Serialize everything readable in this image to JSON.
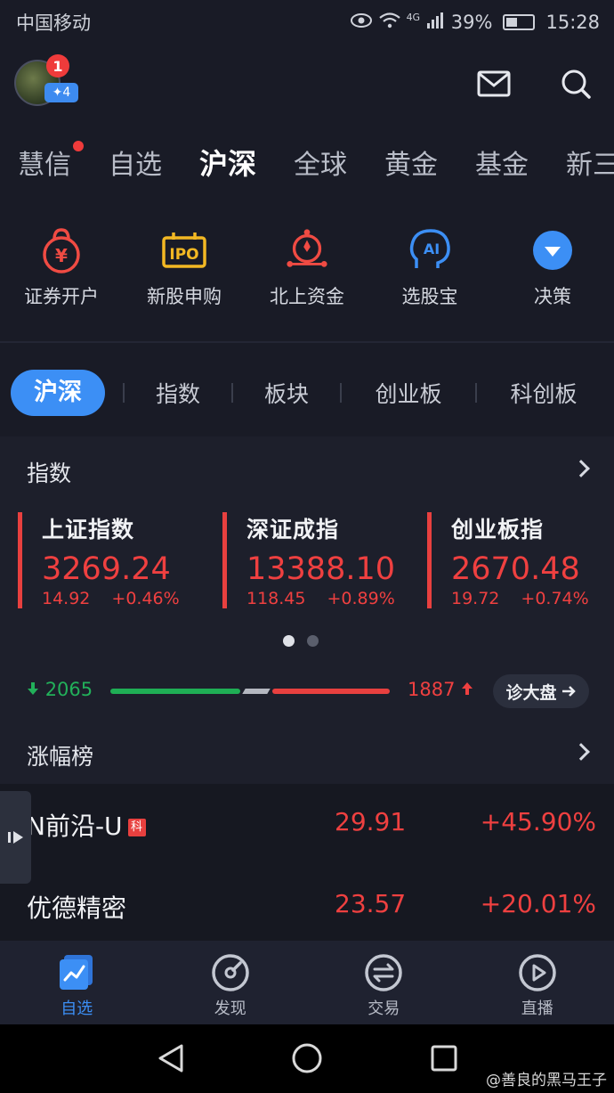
{
  "statusbar": {
    "carrier": "中国移动",
    "network": "4G",
    "battery": "39%",
    "time": "15:28"
  },
  "header": {
    "notifications": "1",
    "level": "✦4"
  },
  "top_tabs": [
    "慧信",
    "自选",
    "沪深",
    "全球",
    "黄金",
    "基金",
    "新三板"
  ],
  "active_top_tab": "沪深",
  "quick_actions": [
    {
      "label": "证券开户",
      "icon": "account-bag-icon"
    },
    {
      "label": "新股申购",
      "icon": "ipo-icon"
    },
    {
      "label": "北上资金",
      "icon": "hk-flow-icon"
    },
    {
      "label": "选股宝",
      "icon": "ai-head-icon"
    },
    {
      "label": "决策",
      "icon": "decision-icon"
    }
  ],
  "sub_tabs": [
    "沪深",
    "指数",
    "板块",
    "创业板",
    "科创板"
  ],
  "index_section": {
    "title": "指数"
  },
  "indices": [
    {
      "name": "上证指数",
      "value": "3269.24",
      "change": "14.92",
      "pct": "+0.46%"
    },
    {
      "name": "深证成指",
      "value": "13388.10",
      "change": "118.45",
      "pct": "+0.89%"
    },
    {
      "name": "创业板指",
      "value": "2670.48",
      "change": "19.72",
      "pct": "+0.74%"
    }
  ],
  "breadth": {
    "down": "2065",
    "up": "1887",
    "diagnose_label": "诊大盘"
  },
  "gainers": {
    "title": "涨幅榜",
    "rows": [
      {
        "name": "N前沿-U",
        "tag": "科",
        "price": "29.91",
        "pct": "+45.90%"
      },
      {
        "name": "优德精密",
        "tag": "",
        "price": "23.57",
        "pct": "+20.01%"
      }
    ]
  },
  "bottom_nav": [
    {
      "label": "自选",
      "icon": "chart-trend-icon",
      "active": true
    },
    {
      "label": "发现",
      "icon": "compass-icon",
      "active": false
    },
    {
      "label": "交易",
      "icon": "exchange-icon",
      "active": false
    },
    {
      "label": "直播",
      "icon": "play-icon",
      "active": false
    }
  ],
  "watermark": "@善良的黑马王子",
  "colors": {
    "rise": "#ef4040",
    "fall": "#22b05a",
    "accent": "#3c8ff5",
    "background": "#191b26"
  }
}
